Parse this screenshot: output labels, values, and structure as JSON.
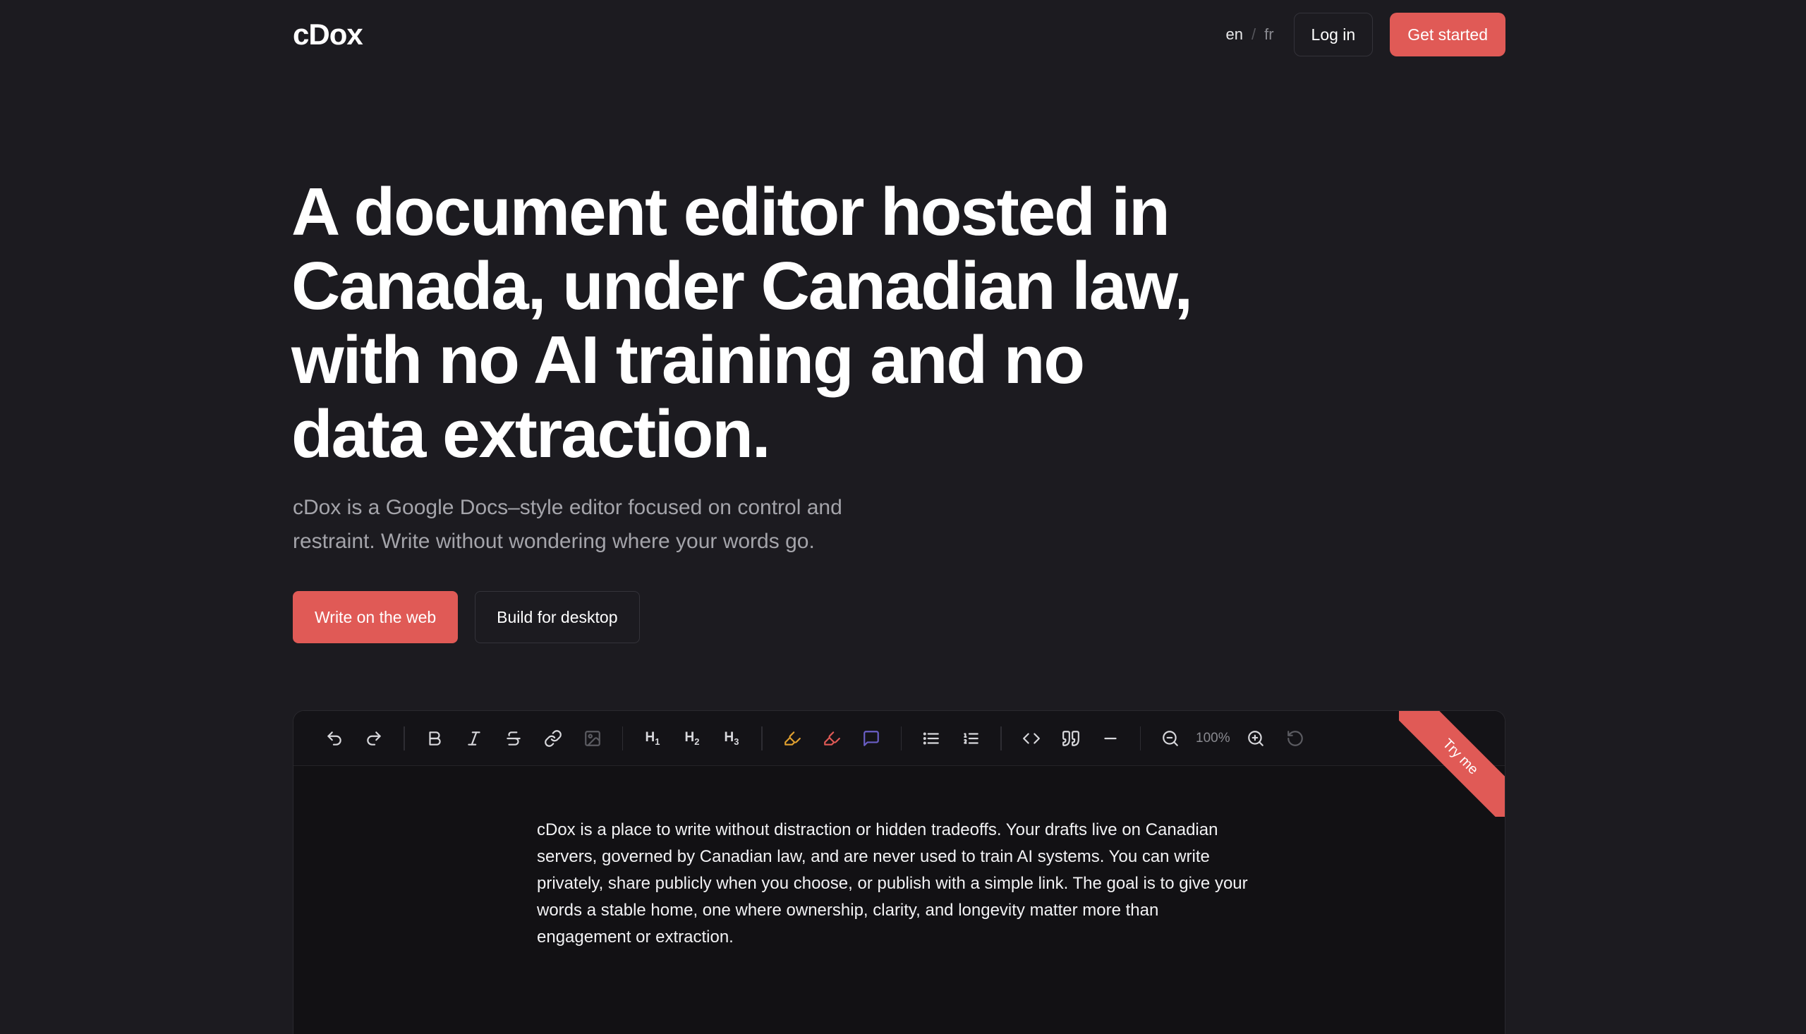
{
  "header": {
    "logo": "cDox",
    "lang_en": "en",
    "lang_sep": "/",
    "lang_fr": "fr",
    "login_label": "Log in",
    "get_started_label": "Get started"
  },
  "hero": {
    "title": "A document editor hosted in Canada, under Canadian law, with no AI training and no data extraction.",
    "subtitle": "cDox is a Google Docs–style editor focused on control and restraint. Write without wondering where your words go.",
    "primary_cta": "Write on the web",
    "secondary_cta": "Build for desktop"
  },
  "editor": {
    "ribbon_label": "Try me",
    "zoom_level": "100%",
    "toolbar_icons": [
      "undo-icon",
      "redo-icon",
      "bold-icon",
      "italic-icon",
      "strikethrough-icon",
      "link-icon",
      "image-icon",
      "heading-1",
      "heading-2",
      "heading-3",
      "highlight-icon",
      "clear-highlight-icon",
      "comment-icon",
      "bullet-list-icon",
      "ordered-list-icon",
      "code-icon",
      "quote-icon",
      "horizontal-rule-icon",
      "zoom-out-icon",
      "zoom-in-icon",
      "reset-zoom-icon"
    ],
    "heading_labels": {
      "h1": "H",
      "h2": "H",
      "h3": "H",
      "n1": "1",
      "n2": "2",
      "n3": "3"
    },
    "colors": {
      "highlight": "#e0a030",
      "clear_highlight": "#e05a56",
      "comment": "#6b5fc7"
    },
    "body_text": "cDox is a place to write without distraction or hidden tradeoffs. Your drafts live on Canadian servers, governed by Canadian law, and are never used to train AI systems. You can write privately, share publicly when you choose, or publish with a simple link. The goal is to give your words a stable home, one where ownership, clarity, and longevity matter more than engagement or extraction."
  },
  "colors": {
    "background": "#1c1b20",
    "accent": "#e05a56",
    "muted_text": "#a4a4aa"
  }
}
